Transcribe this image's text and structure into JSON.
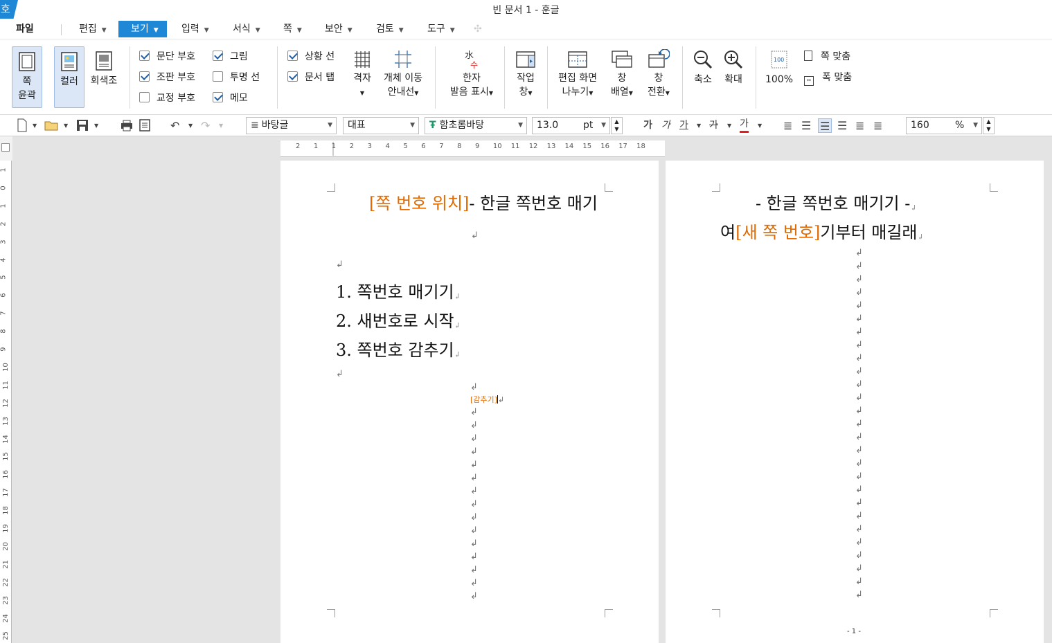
{
  "window": {
    "title": "빈 문서 1 - 훈글",
    "logo": "호"
  },
  "menu": {
    "file": "파일",
    "items": [
      {
        "label": "편집"
      },
      {
        "label": "보기"
      },
      {
        "label": "입력"
      },
      {
        "label": "서식"
      },
      {
        "label": "쪽"
      },
      {
        "label": "보안"
      },
      {
        "label": "검토"
      },
      {
        "label": "도구"
      }
    ],
    "active": "보기"
  },
  "ribbon": {
    "page_outline": {
      "l1": "쪽",
      "l2": "윤곽"
    },
    "color": "컬러",
    "grayscale": "회색조",
    "checks": [
      {
        "label": "문단 부호",
        "checked": true
      },
      {
        "label": "조판 부호",
        "checked": true
      },
      {
        "label": "교정 부호",
        "checked": false
      },
      {
        "label": "그림",
        "checked": true
      },
      {
        "label": "투명 선",
        "checked": false
      },
      {
        "label": "메모",
        "checked": true
      },
      {
        "label": "상황 선",
        "checked": true
      },
      {
        "label": "문서 탭",
        "checked": true
      }
    ],
    "grid": {
      "l1": "격자"
    },
    "object_move_guide": {
      "l1": "개체 이동",
      "l2": "안내선"
    },
    "hanja": {
      "l1": "한자",
      "l2": "발음 표시"
    },
    "task_pane": {
      "l1": "작업",
      "l2": "창"
    },
    "split_view": {
      "l1": "편집 화면",
      "l2": "나누기"
    },
    "arrange": {
      "l1": "창",
      "l2": "배열"
    },
    "switch": {
      "l1": "창",
      "l2": "전환"
    },
    "zoom_out": "축소",
    "zoom_in": "확대",
    "zoom_100": "100%",
    "fit_page": "쪽 맞춤",
    "fit_width": "폭 맞춤"
  },
  "toolbar": {
    "style": "바탕글",
    "language": "대표",
    "font": "함초롬바탕",
    "font_size": "13.0",
    "size_unit": "pt",
    "bold": "가",
    "italic": "가",
    "underline": "가",
    "strike": "가",
    "font_color": "가",
    "zoom_value": "160",
    "zoom_unit": "%"
  },
  "ruler": {
    "h": [
      "2",
      "1",
      "1",
      "2",
      "3",
      "4",
      "5",
      "6",
      "7",
      "8",
      "9",
      "10",
      "11",
      "12",
      "13",
      "14",
      "15",
      "16",
      "17",
      "18"
    ],
    "v": [
      "1",
      "0",
      "1",
      "2",
      "3",
      "4",
      "5",
      "6",
      "7",
      "8",
      "9",
      "10",
      "11",
      "12",
      "13",
      "14",
      "15",
      "16",
      "17",
      "18",
      "19",
      "20",
      "21",
      "22",
      "23",
      "24",
      "25"
    ]
  },
  "document": {
    "page1": {
      "heading_orange": "[쪽 번호 위치]",
      "heading_black": "- 한글 쪽번호 매기",
      "list": [
        "1. 쪽번호 매기기",
        "2. 새번호로 시작",
        "3. 쪽번호 감추기"
      ],
      "hidden_code": "[감추기]"
    },
    "page2": {
      "line1": "- 한글 쪽번호 매기기 -",
      "line2_pre": "여",
      "line2_orange": "[새 쪽 번호]",
      "line2_post": "기부터 매길래",
      "page_number": "- 1 -"
    }
  },
  "colors": {
    "accent": "#1e88d6",
    "code_orange": "#e26a00"
  }
}
